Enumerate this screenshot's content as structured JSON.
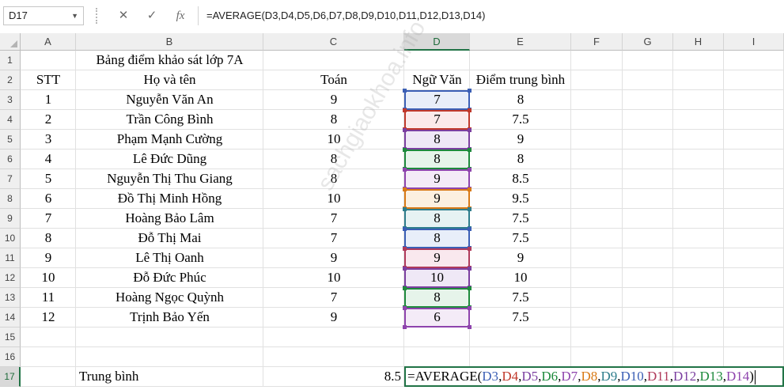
{
  "formula_bar": {
    "name_box": "D17",
    "cancel_glyph": "✕",
    "enter_glyph": "✓",
    "fx_glyph": "fx",
    "formula": "=AVERAGE(D3,D4,D5,D6,D7,D8,D9,D10,D11,D12,D13,D14)"
  },
  "columns": [
    "A",
    "B",
    "C",
    "D",
    "E",
    "F",
    "G",
    "H",
    "I"
  ],
  "selected_column": "D",
  "rows": [
    "1",
    "2",
    "3",
    "4",
    "5",
    "6",
    "7",
    "8",
    "9",
    "10",
    "11",
    "12",
    "13",
    "14",
    "15",
    "16",
    "17"
  ],
  "selected_row": "17",
  "sheet": {
    "title": "Bảng điểm khảo sát lớp 7A",
    "headers": {
      "stt": "STT",
      "name": "Họ và tên",
      "math": "Toán",
      "lit": "Ngữ Văn",
      "avg": "Điểm trung bình"
    },
    "students": [
      {
        "stt": "1",
        "name": "Nguyễn Văn An",
        "math": "9",
        "lit": "7",
        "avg": "8"
      },
      {
        "stt": "2",
        "name": "Trần Công Bình",
        "math": "8",
        "lit": "7",
        "avg": "7.5"
      },
      {
        "stt": "3",
        "name": "Phạm Mạnh Cường",
        "math": "10",
        "lit": "8",
        "avg": "9"
      },
      {
        "stt": "4",
        "name": "Lê Đức Dũng",
        "math": "8",
        "lit": "8",
        "avg": "8"
      },
      {
        "stt": "5",
        "name": "Nguyễn Thị Thu Giang",
        "math": "8",
        "lit": "9",
        "avg": "8.5"
      },
      {
        "stt": "6",
        "name": "Đồ Thị Minh Hồng",
        "math": "10",
        "lit": "9",
        "avg": "9.5"
      },
      {
        "stt": "7",
        "name": "Hoàng Bảo Lâm",
        "math": "7",
        "lit": "8",
        "avg": "7.5"
      },
      {
        "stt": "8",
        "name": "Đỗ Thị Mai",
        "math": "7",
        "lit": "8",
        "avg": "7.5"
      },
      {
        "stt": "9",
        "name": "Lê Thị Oanh",
        "math": "9",
        "lit": "9",
        "avg": "9"
      },
      {
        "stt": "10",
        "name": "Đỗ Đức Phúc",
        "math": "10",
        "lit": "10",
        "avg": "10"
      },
      {
        "stt": "11",
        "name": "Hoàng Ngọc Quỳnh",
        "math": "7",
        "lit": "8",
        "avg": "7.5"
      },
      {
        "stt": "12",
        "name": "Trịnh Bảo Yến",
        "math": "9",
        "lit": "6",
        "avg": "7.5"
      }
    ],
    "footer_label": "Trung bình",
    "footer_math_avg": "8.5"
  },
  "editing": {
    "prefix": "=AVERAGE(",
    "refs": [
      "D3",
      "D4",
      "D5",
      "D6",
      "D7",
      "D8",
      "D9",
      "D10",
      "D11",
      "D12",
      "D13",
      "D14"
    ],
    "suffix": ")"
  },
  "ref_colors": [
    "#3b5fb5",
    "#c0392b",
    "#7b3fa0",
    "#1e8a3c",
    "#8e44ad",
    "#d87a16",
    "#2e7d8c",
    "#3b5fb5",
    "#b03a5b",
    "#7b3fa0",
    "#1e8a3c",
    "#8e44ad"
  ],
  "ref_fills": [
    "#e8eef9",
    "#fbeaea",
    "#efe8f6",
    "#e6f4ea",
    "#f4ebf7",
    "#fcf0e0",
    "#e6f2f3",
    "#e8eef9",
    "#f9e8ee",
    "#efe8f6",
    "#e6f4ea",
    "#f4ebf7"
  ],
  "watermark": "sachgiaokhoa.info"
}
